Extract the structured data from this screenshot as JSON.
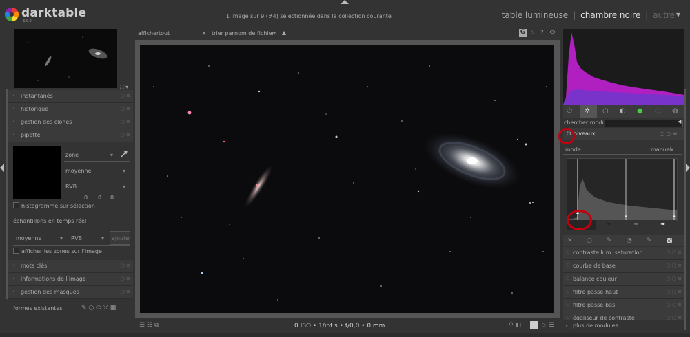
{
  "app": {
    "name": "darktable",
    "version": "3.0.0"
  },
  "header": {
    "collection_info": "1 image sur 9 (#4) sélectionnée dans la collection courante",
    "views": [
      "table lumineuse",
      "chambre noire",
      "autre"
    ],
    "active_view": "chambre noire"
  },
  "filterbar": {
    "show_label": "afficher",
    "show_value": "tout",
    "sort_label": "trier par",
    "sort_value": "nom de fichier"
  },
  "left_modules": {
    "snapshots": "instantanés",
    "history": "historique",
    "duplicates": "gestion des clones",
    "picker": "pipette",
    "tags": "mots clés",
    "image_info": "informations de l'image",
    "masks": "gestion des masques",
    "shapes": "formes existantes"
  },
  "picker": {
    "area": "zone",
    "mean": "moyenne",
    "rgb": "RVB",
    "values": [
      "0",
      "0",
      "0"
    ],
    "histogram_checkbox": "histogramme sur sélection",
    "live_samples": "échantillons en temps réel",
    "live_mean": "moyenne",
    "live_rgb": "RVB",
    "add_button": "ajouter",
    "show_areas": "afficher les zones sur l'image"
  },
  "bottom": {
    "exif": "0 ISO • 1/inf s • f/0,0 • 0 mm"
  },
  "right": {
    "search_label": "chercher module",
    "active_module": "niveaux",
    "mode_label": "mode",
    "mode_value": "manuel",
    "modules": [
      "contraste lum. saturation",
      "courbe de base",
      "balance couleur",
      "filtre passe-haut",
      "filtre passe-bas",
      "égaliseur de contraste"
    ],
    "more_modules": "plus de modules"
  },
  "colors": {
    "accent_red": "#c00010",
    "histogram_magenta": "#b020c0"
  }
}
